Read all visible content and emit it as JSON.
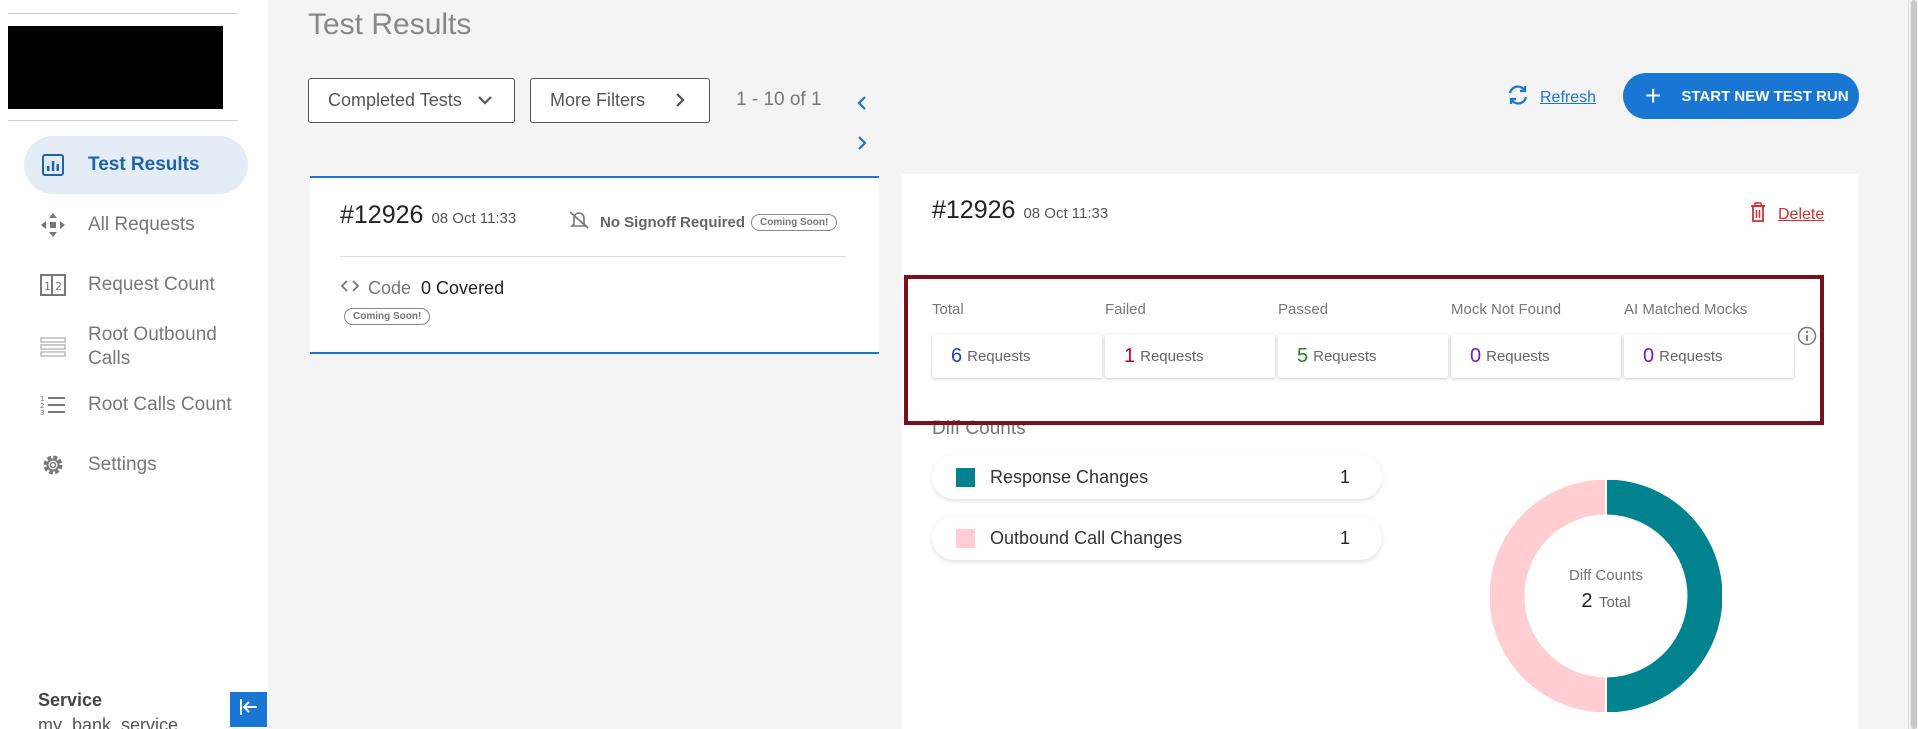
{
  "page": {
    "title": "Test Results"
  },
  "sidebar": {
    "items": [
      {
        "label": "Test Results",
        "icon": "bar-chart-icon"
      },
      {
        "label": "All Requests",
        "icon": "arrows-icon"
      },
      {
        "label": "Request Count",
        "icon": "counter-icon"
      },
      {
        "label": "Root Outbound Calls",
        "icon": "stack-icon"
      },
      {
        "label": "Root Calls Count",
        "icon": "numbered-list-icon"
      },
      {
        "label": "Settings",
        "icon": "gear-icon"
      }
    ],
    "service_title": "Service",
    "service_name": "my_bank_service"
  },
  "toolbar": {
    "completed_filter": "Completed Tests",
    "more_filters": "More Filters",
    "pagination": "1 - 10 of 1",
    "refresh_label": "Refresh",
    "start_label": "START NEW TEST RUN"
  },
  "run_card": {
    "id": "#12926",
    "date": "08 Oct 11:33",
    "signoff": "No Signoff Required",
    "signoff_badge": "Coming Soon!",
    "code_label": "Code",
    "code_value": "0 Covered",
    "code_badge": "Coming Soon!"
  },
  "detail": {
    "id": "#12926",
    "date": "08 Oct 11:33",
    "delete_label": "Delete",
    "stats": [
      {
        "label": "Total",
        "value": "6",
        "unit": "Requests",
        "color": "#1f3fbf"
      },
      {
        "label": "Failed",
        "value": "1",
        "unit": "Requests",
        "color": "#d0021b"
      },
      {
        "label": "Passed",
        "value": "5",
        "unit": "Requests",
        "color": "#2e7d32"
      },
      {
        "label": "Mock Not Found",
        "value": "0",
        "unit": "Requests",
        "color": "#7b1fa2"
      },
      {
        "label": "AI Matched Mocks",
        "value": "0",
        "unit": "Requests",
        "color": "#7b1fa2"
      }
    ],
    "diff_title": "Diff Counts",
    "diffs": [
      {
        "label": "Response Changes",
        "count": "1",
        "color": "#00838f"
      },
      {
        "label": "Outbound Call Changes",
        "count": "1",
        "color": "#ffcdd2"
      }
    ],
    "donut_title": "Diff Counts",
    "donut_total": "2",
    "donut_total_label": "Total"
  },
  "colors": {
    "accent": "#1976d2",
    "danger": "#d32f2f",
    "highlight": "#7a0f1f"
  }
}
